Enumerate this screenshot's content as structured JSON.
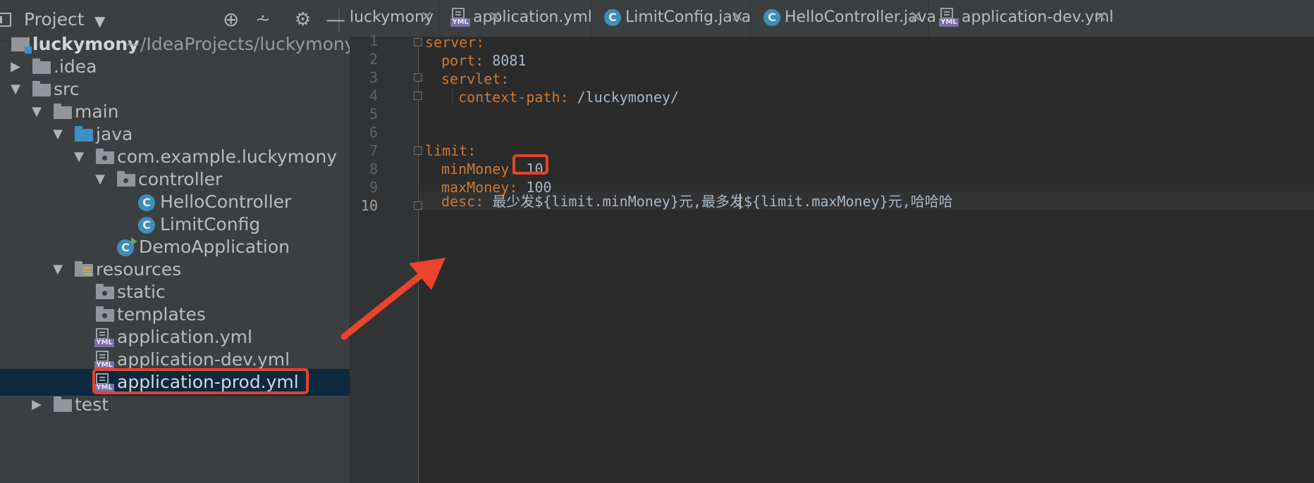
{
  "project_panel": {
    "title": "Project",
    "tree": [
      {
        "label": "luckymony",
        "suffix": "~/IdeaProjects/luckymony"
      },
      {
        "label": ".idea"
      },
      {
        "label": "src"
      },
      {
        "label": "main"
      },
      {
        "label": "java"
      },
      {
        "label": "com.example.luckymony"
      },
      {
        "label": "controller"
      },
      {
        "label": "HelloController"
      },
      {
        "label": "LimitConfig"
      },
      {
        "label": "DemoApplication"
      },
      {
        "label": "resources"
      },
      {
        "label": "static"
      },
      {
        "label": "templates"
      },
      {
        "label": "application.yml"
      },
      {
        "label": "application-dev.yml"
      },
      {
        "label": "application-prod.yml"
      },
      {
        "label": "test"
      }
    ]
  },
  "tabs": [
    {
      "label": "luckymony"
    },
    {
      "label": "application.yml"
    },
    {
      "label": "LimitConfig.java"
    },
    {
      "label": "HelloController.java"
    },
    {
      "label": "application-dev.yml"
    }
  ],
  "icons": {
    "class_letter": "C",
    "yml_tag": "YML"
  },
  "editor": {
    "line_numbers": [
      "1",
      "2",
      "3",
      "4",
      "5",
      "6",
      "7",
      "8",
      "9",
      "10"
    ],
    "lines": [
      {
        "key": "server",
        "colon": ":",
        "value": ""
      },
      {
        "key": "port",
        "colon": ":",
        "value": " 8081"
      },
      {
        "key": "servlet",
        "colon": ":",
        "value": ""
      },
      {
        "key": "context-path",
        "colon": ":",
        "value": " /luckymoney/"
      },
      {
        "key": "",
        "colon": "",
        "value": ""
      },
      {
        "key": "",
        "colon": "",
        "value": ""
      },
      {
        "key": "limit",
        "colon": ":",
        "value": ""
      },
      {
        "key": "minMoney",
        "colon": ":",
        "value": " 10"
      },
      {
        "key": "maxMoney",
        "colon": ":",
        "value": " 100"
      },
      {
        "key": "desc",
        "colon": ":",
        "value": " 最少发${limit.minMoney}元,最多发${limit.maxMoney}元,哈哈哈"
      }
    ]
  },
  "colors": {
    "highlight": "#e5432c",
    "key": "#cc7832",
    "value": "#a9b7c6",
    "selection": "#0d293e"
  }
}
